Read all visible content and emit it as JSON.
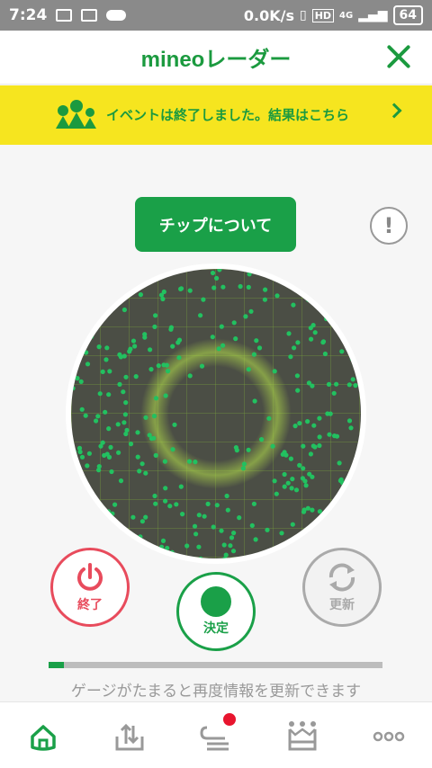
{
  "status_bar": {
    "time": "7:24",
    "network_speed": "0.0K/s",
    "network_type": "4G",
    "hd_label": "HD",
    "battery": "64"
  },
  "header": {
    "title": "mineoレーダー"
  },
  "banner": {
    "text": "イベントは終了しました。結果はこちら"
  },
  "actions": {
    "chip_button": "チップについて",
    "info_icon": "!"
  },
  "controls": {
    "end_label": "終了",
    "decide_label": "決定",
    "refresh_label": "更新"
  },
  "gauge": {
    "fill_fraction": 0.045,
    "caption": "ゲージがたまると再度情報を更新できます"
  },
  "colors": {
    "brand_green": "#1aa048",
    "banner_yellow": "#f6e51f",
    "end_red": "#e84b5c",
    "badge_red": "#e8152e"
  },
  "bottom_nav": {
    "items": [
      {
        "icon": "home-icon"
      },
      {
        "icon": "tray-upload-icon"
      },
      {
        "icon": "chat-icon",
        "has_badge": true
      },
      {
        "icon": "crown-icon"
      },
      {
        "icon": "more-icon"
      }
    ]
  }
}
